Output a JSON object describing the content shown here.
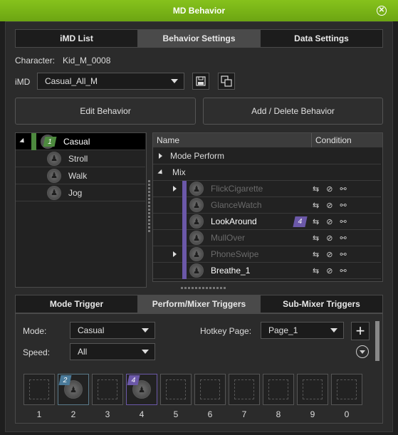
{
  "window": {
    "title": "MD Behavior"
  },
  "top_tabs": [
    {
      "label": "iMD List"
    },
    {
      "label": "Behavior Settings"
    },
    {
      "label": "Data Settings"
    }
  ],
  "character": {
    "label": "Character:",
    "value": "Kid_M_0008"
  },
  "imd": {
    "label": "iMD",
    "value": "Casual_All_M"
  },
  "buttons": {
    "edit": "Edit Behavior",
    "add_delete": "Add / Delete Behavior"
  },
  "mode_list": [
    {
      "label": "Casual",
      "badge": "1"
    },
    {
      "label": "Stroll"
    },
    {
      "label": "Walk"
    },
    {
      "label": "Jog"
    }
  ],
  "tree": {
    "col_name": "Name",
    "col_condition": "Condition",
    "groups": [
      {
        "label": "Mode Perform"
      },
      {
        "label": "Mix"
      }
    ],
    "items": [
      {
        "label": "FlickCigarette",
        "dimmed": true
      },
      {
        "label": "GlanceWatch",
        "dimmed": true
      },
      {
        "label": "LookAround",
        "dimmed": false,
        "badge": "4"
      },
      {
        "label": "MullOver",
        "dimmed": true
      },
      {
        "label": "PhoneSwipe",
        "dimmed": true
      },
      {
        "label": "Breathe_1",
        "dimmed": false
      }
    ]
  },
  "bottom_tabs": [
    {
      "label": "Mode Trigger"
    },
    {
      "label": "Perform/Mixer Triggers"
    },
    {
      "label": "Sub-Mixer Triggers"
    }
  ],
  "triggers": {
    "mode_label": "Mode:",
    "mode_value": "Casual",
    "speed_label": "Speed:",
    "speed_value": "All",
    "hotkey_label": "Hotkey Page:",
    "hotkey_value": "Page_1"
  },
  "hotkeys": [
    {
      "num": "1"
    },
    {
      "num": "2",
      "badge": "2"
    },
    {
      "num": "3"
    },
    {
      "num": "4",
      "badge": "4"
    },
    {
      "num": "5"
    },
    {
      "num": "6"
    },
    {
      "num": "7"
    },
    {
      "num": "8"
    },
    {
      "num": "9"
    },
    {
      "num": "0"
    }
  ],
  "colors": {
    "title_green": "#7ab51a",
    "badge_green": "#4d8a3e",
    "badge_purple": "#6b58a8",
    "badge_blue": "#4a7a9a"
  }
}
